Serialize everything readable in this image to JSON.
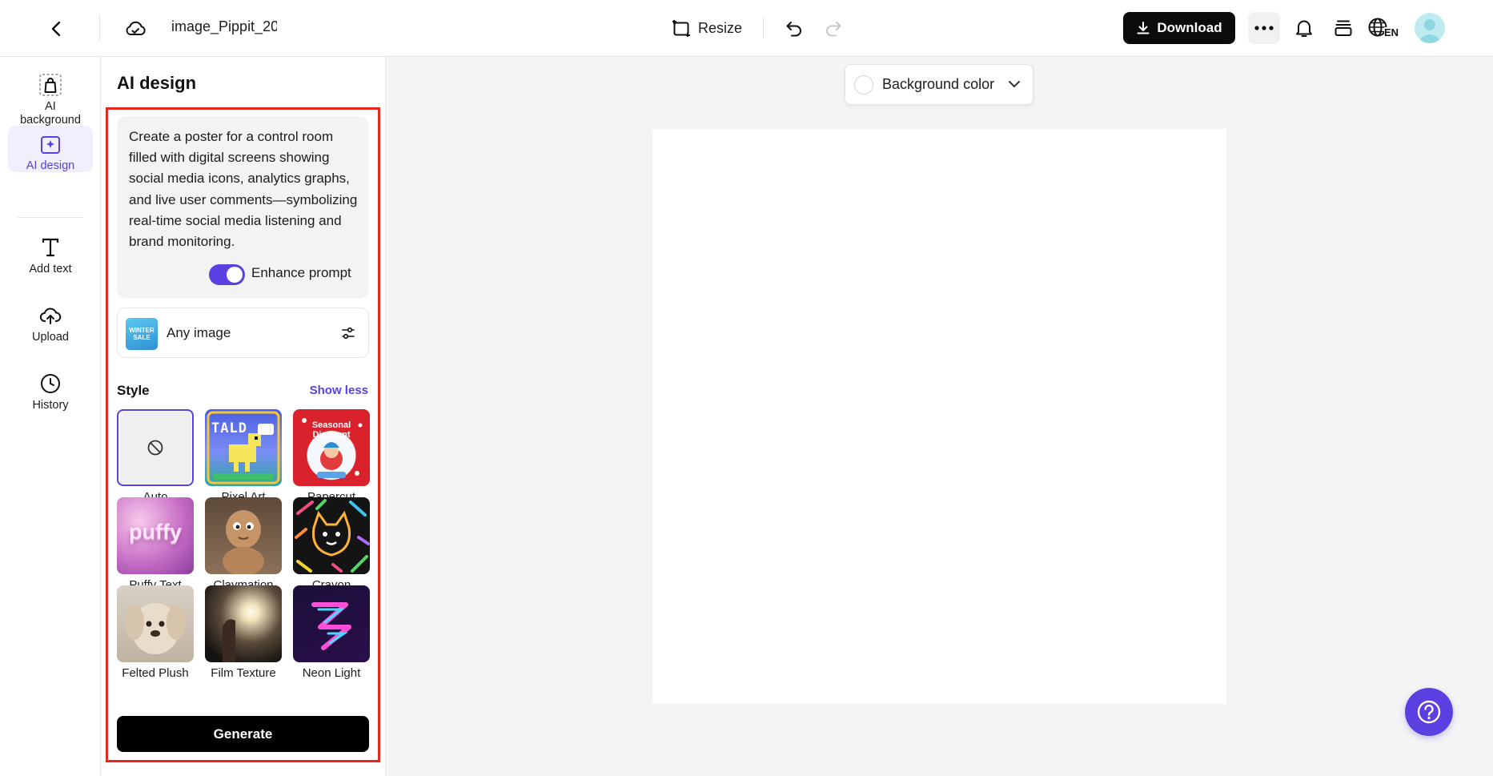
{
  "header": {
    "file_name": "image_Pippit_20",
    "resize_label": "Resize",
    "download_label": "Download",
    "language_code": "EN"
  },
  "rail": {
    "items": [
      {
        "label": "AI\nbackground",
        "icon": "bag-icon"
      },
      {
        "label": "AI design",
        "icon": "ai-design-icon",
        "active": true
      },
      {
        "label": "Add text",
        "icon": "text-icon"
      },
      {
        "label": "Upload",
        "icon": "upload-icon"
      },
      {
        "label": "History",
        "icon": "clock-icon"
      }
    ]
  },
  "panel": {
    "title": "AI design",
    "prompt": "Create a poster for a control room filled with digital screens showing social media icons, analytics graphs, and live user comments—symbolizing real-time social media listening and brand monitoring.",
    "enhance_prompt_label": "Enhance prompt",
    "enhance_prompt_on": true,
    "image_option_label": "Any image",
    "image_thumb_text": "WINTER SALE",
    "style_heading": "Style",
    "show_less_label": "Show less",
    "styles": [
      {
        "name": "Auto",
        "selected": true
      },
      {
        "name": "Pixel Art",
        "tile_text": "TALD"
      },
      {
        "name": "Papercut",
        "tile_text": "Seasonal Discount"
      },
      {
        "name": "Puffy Text",
        "tile_text": "puffy"
      },
      {
        "name": "Claymation"
      },
      {
        "name": "Crayon"
      },
      {
        "name": "Felted Plush"
      },
      {
        "name": "Film Texture"
      },
      {
        "name": "Neon Light"
      }
    ],
    "generate_label": "Generate"
  },
  "canvas": {
    "background_color_label": "Background color"
  },
  "colors": {
    "accent": "#5b3fe0",
    "highlight_box": "#e8281f",
    "primary_button": "#000000"
  }
}
